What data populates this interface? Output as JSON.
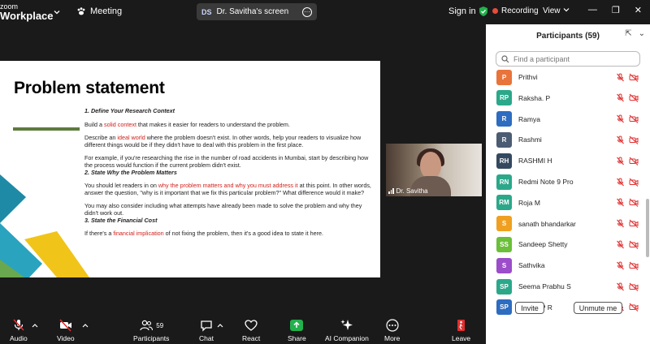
{
  "app": {
    "logo_line1": "zoom",
    "logo_line2": "Workplace"
  },
  "topbar": {
    "meeting_label": "Meeting",
    "share_initials": "DS",
    "share_label": "Dr. Savitha's screen",
    "signin_label": "Sign in",
    "recording_label": "Recording",
    "view_label": "View",
    "recording_color": "#e74c3c",
    "shield_color": "#22b14c"
  },
  "slide": {
    "title": "Problem statement",
    "h1": "1. Define Your Research Context",
    "p1_a": "Build a ",
    "p1_red": "solid context",
    "p1_b": " that makes it easier for readers to understand the problem.",
    "p2_a": "Describe an ",
    "p2_red": "ideal world",
    "p2_b": " where the problem doesn't exist. In other words, help your readers to visualize how different things would be if they didn't have to deal with this problem in the first place.",
    "p3": "For example, if you're researching the rise in the number of road accidents in Mumbai, start by describing how the process would function if the current problem didn't exist.",
    "h2": "2. State Why the Problem Matters",
    "p4_a": "You should let readers in on ",
    "p4_red": "why the problem matters and why you must address it",
    "p4_b": " at this point. In other words, answer the question, \"why is it important that we fix this particular problem?\" What difference would it make?",
    "p5": "You may also consider including what attempts have already been made to solve the problem and why they didn't work out.",
    "h3": "3. State the Financial Cost",
    "p6_a": "If there's a ",
    "p6_red": "financial implication",
    "p6_b": " of not fixing the problem, then it's a good idea to state it here."
  },
  "video": {
    "name": "Dr. Savitha"
  },
  "participants": {
    "title": "Participants (59)",
    "search_placeholder": "Find a participant",
    "invite_label": "Invite",
    "unmute_label": "Unmute me",
    "list": [
      {
        "initials": "P",
        "name": "Prithvi",
        "color": "#e8743b"
      },
      {
        "initials": "RP",
        "name": "Raksha. P",
        "color": "#2ba88a"
      },
      {
        "initials": "R",
        "name": "Ramya",
        "color": "#2d6cc0"
      },
      {
        "initials": "R",
        "name": "Rashmi",
        "color": "#4b5c73"
      },
      {
        "initials": "RH",
        "name": "RASHMI H",
        "color": "#34495e"
      },
      {
        "initials": "RN",
        "name": "Redmi Note 9 Pro",
        "color": "#2ba88a"
      },
      {
        "initials": "RM",
        "name": "Roja M",
        "color": "#2ba88a"
      },
      {
        "initials": "S",
        "name": "sanath bhandarkar",
        "color": "#f0a020"
      },
      {
        "initials": "SS",
        "name": "Sandeep Shetty",
        "color": "#6bbf3a"
      },
      {
        "initials": "S",
        "name": "Sathvika",
        "color": "#9b4dca"
      },
      {
        "initials": "SP",
        "name": "Seema Prabhu S",
        "color": "#2ba88a"
      },
      {
        "initials": "SP",
        "name": "Shalini P R",
        "color": "#2d6cc0"
      }
    ]
  },
  "toolbar": {
    "audio": "Audio",
    "video": "Video",
    "participants": "Participants",
    "participants_count": "59",
    "chat": "Chat",
    "react": "React",
    "share": "Share",
    "ai": "AI Companion",
    "more": "More",
    "leave": "Leave",
    "share_color": "#22b14c",
    "leave_color": "#e02f2f"
  }
}
